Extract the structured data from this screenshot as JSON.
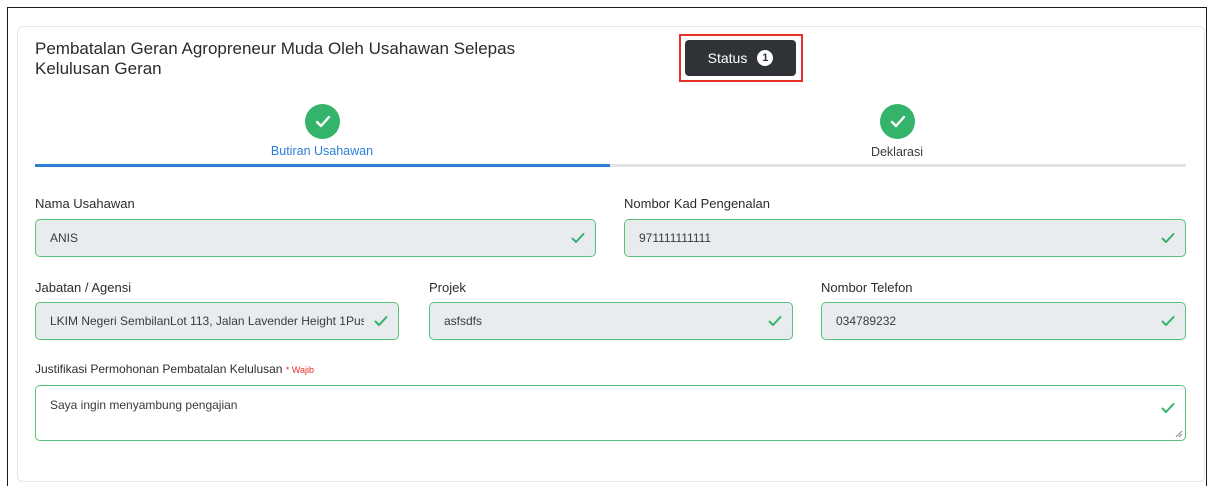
{
  "page": {
    "title": "Pembatalan Geran Agropreneur Muda Oleh Usahawan Selepas Kelulusan Geran"
  },
  "status_button": {
    "label": "Status",
    "badge": "1",
    "highlight_color": "#e8302a"
  },
  "steps": [
    {
      "label": "Butiran Usahawan",
      "state": "complete",
      "active": true,
      "icon": "check-icon"
    },
    {
      "label": "Deklarasi",
      "state": "complete",
      "active": false,
      "icon": "check-icon"
    }
  ],
  "colors": {
    "success": "#34b36b",
    "active_tab": "#2b7fd9",
    "valid_border": "#58c27d",
    "required": "#e8302a"
  },
  "form": {
    "nama_usahawan": {
      "label": "Nama Usahawan",
      "value": "ANIS"
    },
    "nombor_kad": {
      "label": "Nombor Kad Pengenalan",
      "value": "971111111111"
    },
    "jabatan": {
      "label": "Jabatan / Agensi",
      "value": "LKIM Negeri SembilanLot 113, Jalan Lavender Height 1Pus"
    },
    "projek": {
      "label": "Projek",
      "value": "asfsdfs"
    },
    "nombor_telefon": {
      "label": "Nombor Telefon",
      "value": "034789232"
    },
    "justifikasi": {
      "label": "Justifikasi Permohonan Pembatalan Kelulusan",
      "required_marker": "* Wajib",
      "value": "Saya ingin menyambung pengajian"
    }
  }
}
